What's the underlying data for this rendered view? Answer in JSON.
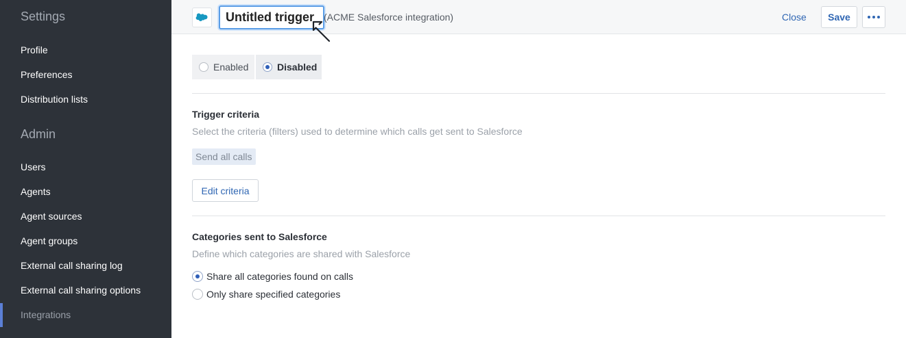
{
  "sidebar": {
    "settings_heading": "Settings",
    "settings_items": [
      "Profile",
      "Preferences",
      "Distribution lists"
    ],
    "admin_heading": "Admin",
    "admin_items": [
      "Users",
      "Agents",
      "Agent sources",
      "Agent groups",
      "External call sharing log",
      "External call sharing options",
      "Integrations"
    ],
    "active_item": "Integrations"
  },
  "header": {
    "logo_icon": "salesforce-cloud-icon",
    "trigger_name": "Untitled trigger",
    "integration_label": "(ACME Salesforce integration)",
    "close_label": "Close",
    "save_label": "Save",
    "more_icon": "more-horizontal-icon"
  },
  "status": {
    "enabled_label": "Enabled",
    "disabled_label": "Disabled",
    "selected": "Disabled"
  },
  "trigger_criteria": {
    "title": "Trigger criteria",
    "description": "Select the criteria (filters) used to determine which calls get sent to Salesforce",
    "tag": "Send all calls",
    "edit_label": "Edit criteria"
  },
  "categories": {
    "title": "Categories sent to Salesforce",
    "description": "Define which categories are shared with Salesforce",
    "options": [
      "Share all categories found on calls",
      "Only share specified categories"
    ],
    "selected": "Share all categories found on calls"
  },
  "colors": {
    "sidebar_bg": "#2d3239",
    "accent": "#2f66b3",
    "salesforce_blue": "#1798c1",
    "focus_ring": "#5a9de6"
  }
}
